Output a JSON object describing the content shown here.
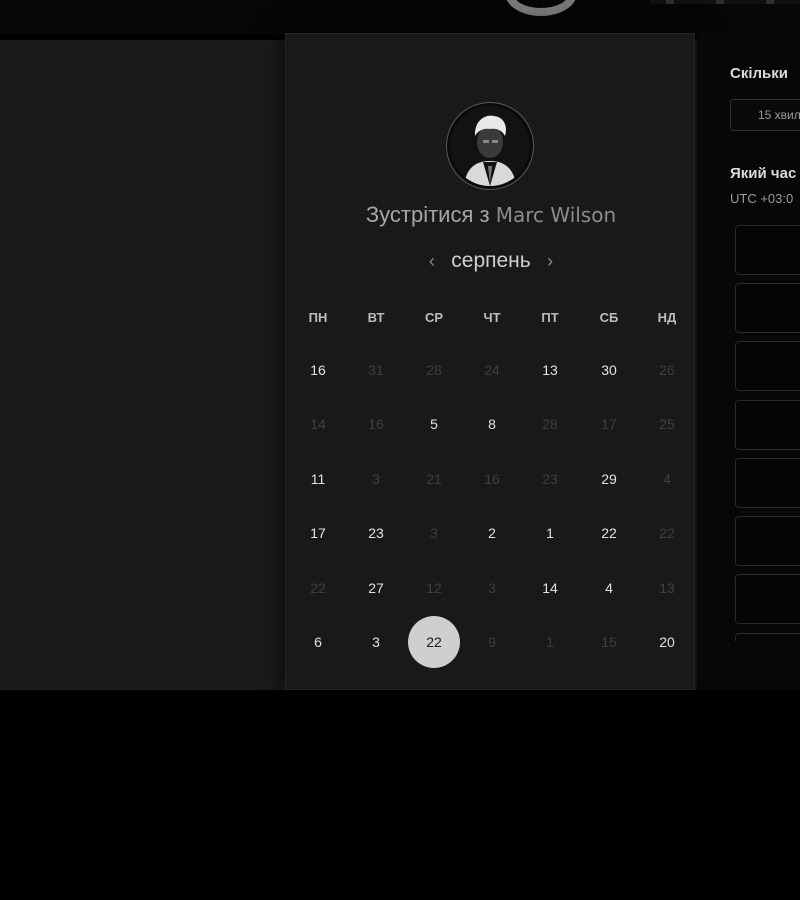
{
  "scheduler": {
    "heading_prefix": "Зустрітися з",
    "host_name": "Marc Wilson",
    "avatar_alt": "avatar",
    "month": "серпень",
    "prev_month_icon": "chevron-left-icon",
    "next_month_icon": "chevron-right-icon",
    "weekdays": [
      "ПН",
      "ВТ",
      "СР",
      "ЧТ",
      "ПТ",
      "СБ",
      "НД"
    ],
    "weeks": [
      [
        {
          "n": "16",
          "state": "active"
        },
        {
          "n": "31",
          "state": "inactive"
        },
        {
          "n": "28",
          "state": "inactive"
        },
        {
          "n": "24",
          "state": "inactive"
        },
        {
          "n": "13",
          "state": "active"
        },
        {
          "n": "30",
          "state": "active"
        },
        {
          "n": "26",
          "state": "inactive"
        }
      ],
      [
        {
          "n": "14",
          "state": "inactive"
        },
        {
          "n": "16",
          "state": "inactive"
        },
        {
          "n": "5",
          "state": "active"
        },
        {
          "n": "8",
          "state": "active"
        },
        {
          "n": "28",
          "state": "inactive"
        },
        {
          "n": "17",
          "state": "inactive"
        },
        {
          "n": "25",
          "state": "inactive"
        }
      ],
      [
        {
          "n": "11",
          "state": "active"
        },
        {
          "n": "3",
          "state": "inactive"
        },
        {
          "n": "21",
          "state": "inactive"
        },
        {
          "n": "16",
          "state": "inactive"
        },
        {
          "n": "23",
          "state": "inactive"
        },
        {
          "n": "29",
          "state": "active"
        },
        {
          "n": "4",
          "state": "inactive"
        }
      ],
      [
        {
          "n": "17",
          "state": "active"
        },
        {
          "n": "23",
          "state": "active"
        },
        {
          "n": "3",
          "state": "inactive"
        },
        {
          "n": "2",
          "state": "active"
        },
        {
          "n": "1",
          "state": "active"
        },
        {
          "n": "22",
          "state": "active"
        },
        {
          "n": "22",
          "state": "inactive"
        }
      ],
      [
        {
          "n": "22",
          "state": "inactive"
        },
        {
          "n": "27",
          "state": "active"
        },
        {
          "n": "12",
          "state": "inactive"
        },
        {
          "n": "3",
          "state": "inactive"
        },
        {
          "n": "14",
          "state": "active"
        },
        {
          "n": "4",
          "state": "active"
        },
        {
          "n": "13",
          "state": "inactive"
        }
      ],
      [
        {
          "n": "6",
          "state": "active"
        },
        {
          "n": "3",
          "state": "active"
        },
        {
          "n": "22",
          "state": "selected"
        },
        {
          "n": "9",
          "state": "inactive"
        },
        {
          "n": "1",
          "state": "inactive"
        },
        {
          "n": "15",
          "state": "inactive"
        },
        {
          "n": "20",
          "state": "active"
        }
      ]
    ]
  },
  "booking": {
    "duration_label": "Скільки",
    "duration_value": "15 хвил",
    "time_label": "Який час",
    "timezone": "UTC +03:0",
    "slots_visible": 7
  },
  "colors": {
    "selected_day_bg": "#cfcfcf",
    "panel_bg": "#191919",
    "side_panel_bg": "#070707"
  }
}
